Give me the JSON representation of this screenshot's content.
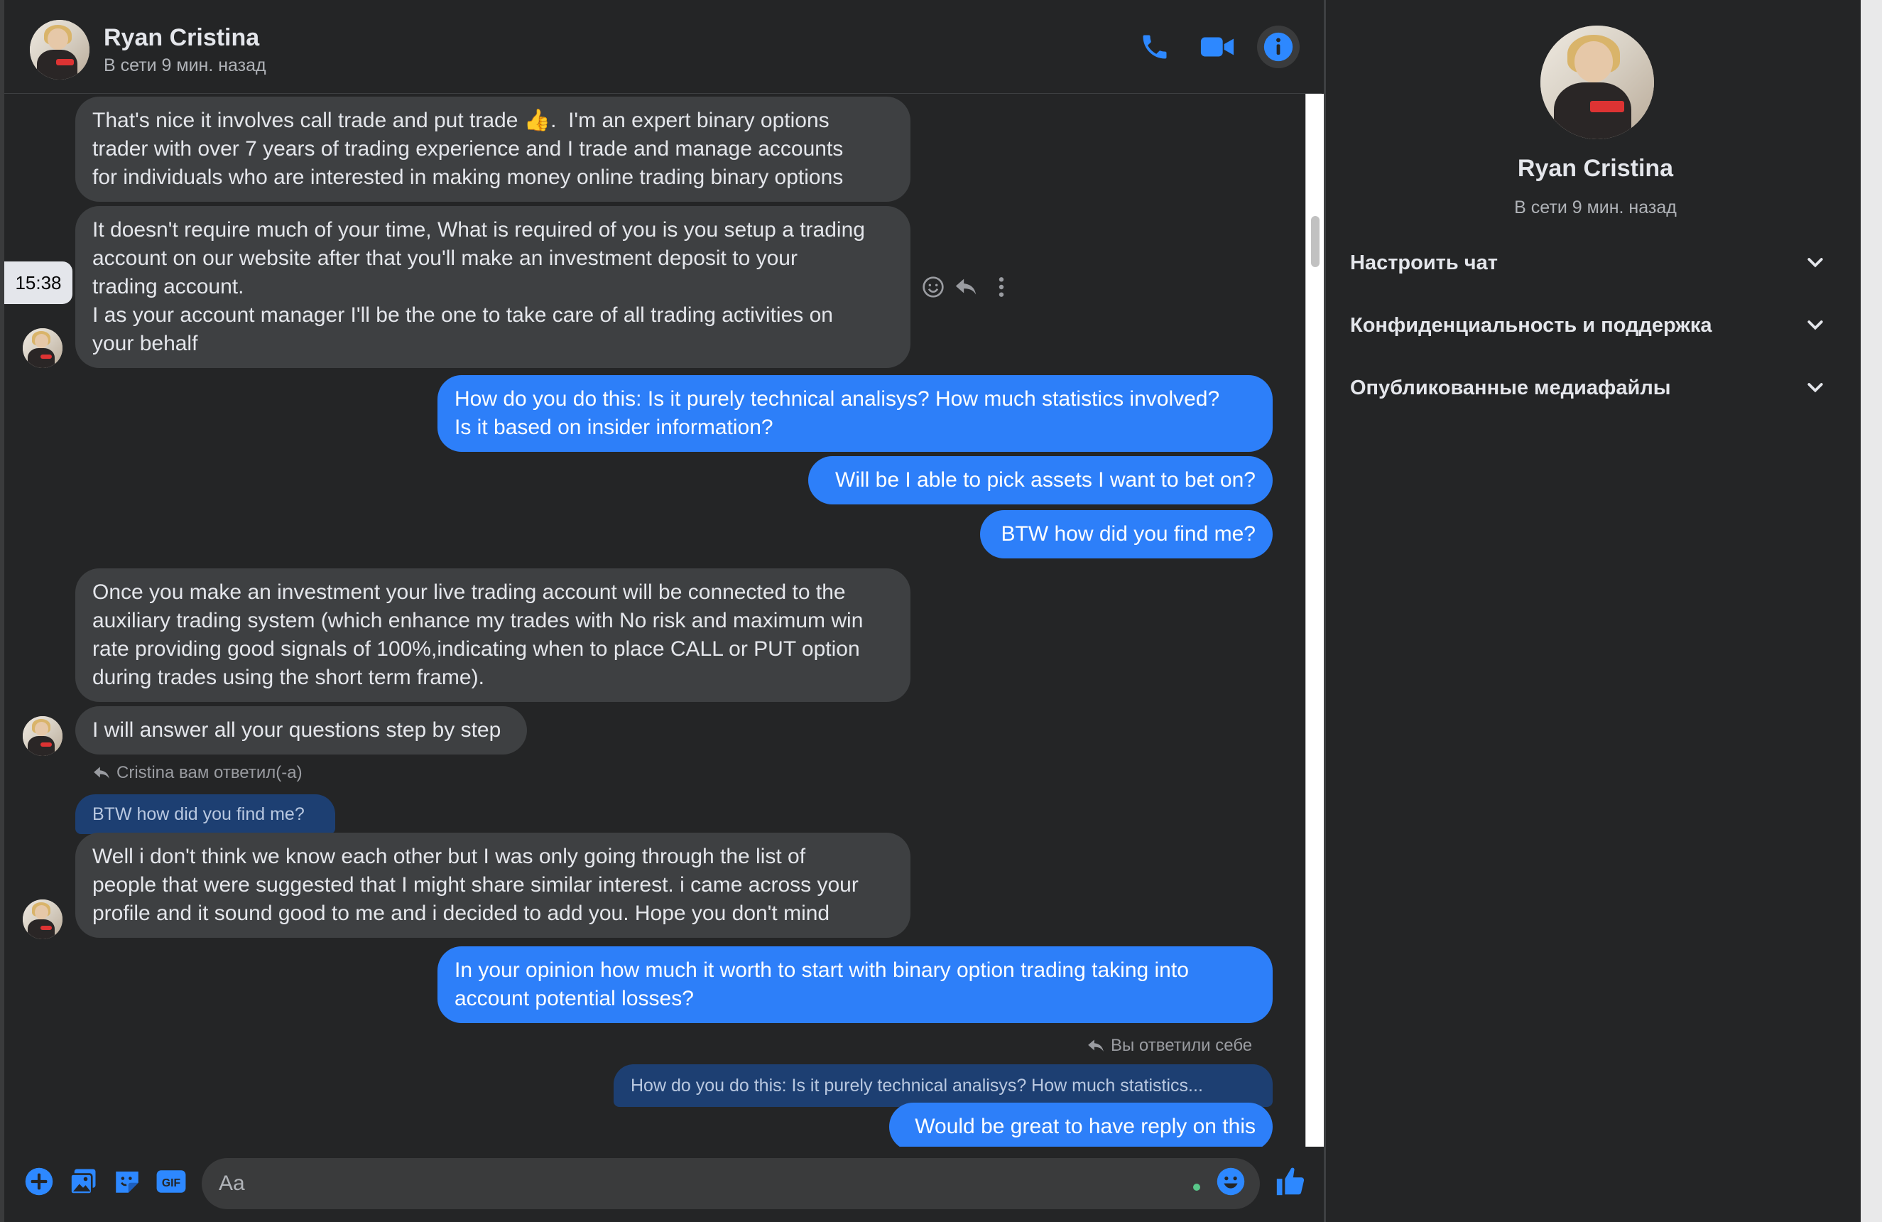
{
  "header": {
    "name": "Ryan Cristina",
    "status": "В сети 9 мин. назад"
  },
  "messages": {
    "m1": "That's nice it involves call trade and put trade 👍.  I'm an expert binary options\ntrader with over 7 years of trading experience and I trade and manage accounts\nfor individuals who are interested in making money online trading binary options",
    "m2": "It doesn't require much of your time, What is required of you is you setup a trading\naccount on our website after that you'll make an investment deposit to your\ntrading account.\nI as your account manager I'll be the one to take care of all trading activities on\nyour behalf",
    "m3": "How do you do this: Is it purely technical analisys? How much statistics involved?\nIs it based on insider information?",
    "m4": "Will be I able to pick assets I want to bet on?",
    "m5": "BTW how did you find me?",
    "m6": "Once you make an investment your live trading account will be connected to the\nauxiliary trading system (which enhance my trades with No risk and maximum win\nrate providing good signals of 100%,indicating when to place CALL or PUT option\nduring trades using the short term frame).",
    "m7": "I will answer all your questions step by step",
    "reply_note_1": "Cristina вам ответил(-а)",
    "quoted_1": "BTW how did you find me?",
    "m8": "Well i don't think we know each other but I was only going through the list of\npeople that were suggested that I might share similar interest. i came across your\nprofile and it sound good to me and i decided to add you. Hope you don't mind",
    "m9": "In your opinion how much it worth to start with binary option trading taking into\naccount potential losses?",
    "reply_note_2": "Вы ответили себе",
    "quoted_2": "How do you do this: Is it purely technical analisys? How much statistics...",
    "m10": "Would be great to have reply on this"
  },
  "timestamp": "15:38",
  "composer": {
    "placeholder": "Aa",
    "gif_label": "GIF"
  },
  "panel": {
    "name": "Ryan Cristina",
    "status": "В сети 9 мин. назад",
    "sections": [
      "Настроить чат",
      "Конфиденциальность и поддержка",
      "Опубликованные медиафайлы"
    ]
  },
  "colors": {
    "accent": "#2d7ff9",
    "background": "#242526",
    "incoming_bubble": "#3e4042"
  },
  "icons": [
    "phone-icon",
    "video-camera-icon",
    "info-icon",
    "plus-icon",
    "image-icon",
    "sticker-icon",
    "gif-icon",
    "emoji-icon",
    "thumbs-up-icon",
    "reply-icon",
    "more-icon",
    "chevron-down-icon"
  ]
}
